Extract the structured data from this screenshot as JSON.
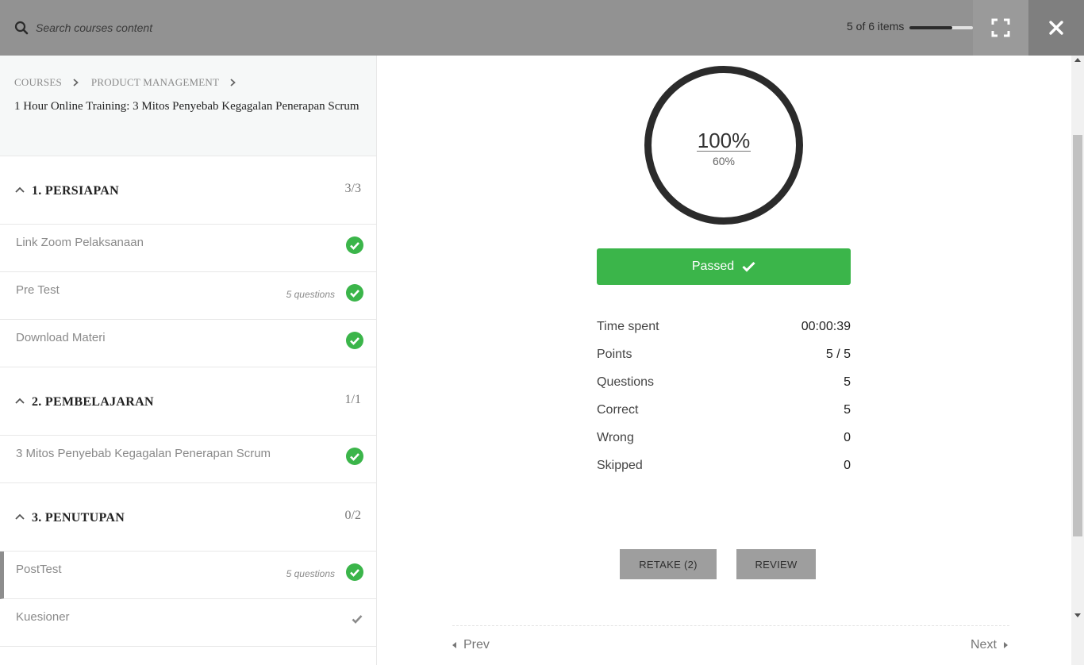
{
  "topbar": {
    "search_placeholder": "Search courses content",
    "progress_text": "5 of 6 items",
    "progress_fraction": 0.67,
    "icons": {
      "search": "search-icon",
      "fullscreen": "fullscreen-icon",
      "close": "close-icon"
    }
  },
  "sidebar": {
    "breadcrumb": [
      "COURSES",
      "PRODUCT MANAGEMENT"
    ],
    "course_title": "1 Hour Online Training: 3 Mitos Penyebab Kegagalan Penerapan Scrum",
    "sections": [
      {
        "title": "1. PERSIAPAN",
        "count": "3/3",
        "items": [
          {
            "title": "Link Zoom Pelaksanaan",
            "meta": "",
            "status": "completed"
          },
          {
            "title": "Pre Test",
            "meta": "5 questions",
            "status": "completed"
          },
          {
            "title": "Download Materi",
            "meta": "",
            "status": "completed"
          }
        ]
      },
      {
        "title": "2. PEMBELAJARAN",
        "count": "1/1",
        "items": [
          {
            "title": "3 Mitos Penyebab Kegagalan Penerapan Scrum",
            "meta": "",
            "status": "completed"
          }
        ]
      },
      {
        "title": "3. PENUTUPAN",
        "count": "0/2",
        "items": [
          {
            "title": "PostTest",
            "meta": "5 questions",
            "status": "completed"
          },
          {
            "title": "Kuesioner",
            "meta": "",
            "status": "viewed"
          }
        ]
      }
    ]
  },
  "result": {
    "score": "100%",
    "passing_grade": "60%",
    "status_label": "Passed",
    "stats": [
      {
        "label": "Time spent",
        "value": "00:00:39"
      },
      {
        "label": "Points",
        "value": "5 / 5"
      },
      {
        "label": "Questions",
        "value": "5"
      },
      {
        "label": "Correct",
        "value": "5"
      },
      {
        "label": "Wrong",
        "value": "0"
      },
      {
        "label": "Skipped",
        "value": "0"
      }
    ],
    "retake_label": "RETAKE (2)",
    "review_label": "REVIEW",
    "prev_label": "Prev",
    "next_label": "Next"
  },
  "colors": {
    "topbar": "#929292",
    "success": "#3bb54a",
    "button": "#9e9e9e",
    "ring": "#2b2b2b"
  }
}
